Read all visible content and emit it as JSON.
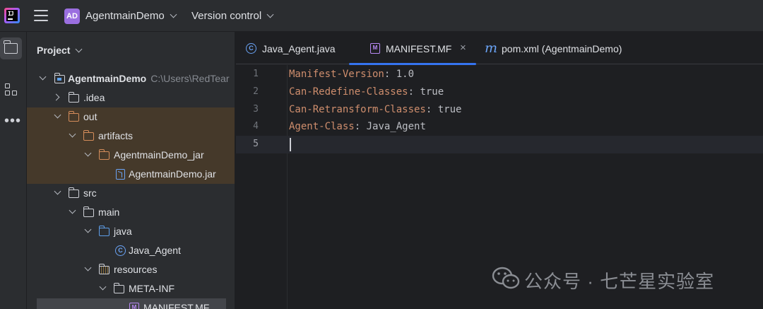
{
  "titlebar": {
    "project_badge": "AD",
    "project_name": "AgentmainDemo",
    "vcs_label": "Version control"
  },
  "project_panel": {
    "title": "Project",
    "tree": [
      {
        "label": "AgentmainDemo",
        "path": "C:\\Users\\RedTear"
      },
      {
        "label": ".idea"
      },
      {
        "label": "out"
      },
      {
        "label": "artifacts"
      },
      {
        "label": "AgentmainDemo_jar"
      },
      {
        "label": "AgentmainDemo.jar"
      },
      {
        "label": "src"
      },
      {
        "label": "main"
      },
      {
        "label": "java"
      },
      {
        "label": "Java_Agent"
      },
      {
        "label": "resources"
      },
      {
        "label": "META-INF"
      },
      {
        "label": "MANIFEST.MF"
      }
    ]
  },
  "tabs": [
    {
      "label": "Java_Agent.java",
      "icon": "java-class-icon"
    },
    {
      "label": "MANIFEST.MF",
      "icon": "manifest-icon",
      "active": true
    },
    {
      "label": "pom.xml (AgentmainDemo)",
      "icon": "maven-icon"
    }
  ],
  "tab_close_glyph": "×",
  "editor": {
    "lines": [
      {
        "num": "1",
        "key": "Manifest-Version",
        "value": " 1.0"
      },
      {
        "num": "2",
        "key": "Can-Redefine-Classes",
        "value": " true"
      },
      {
        "num": "3",
        "key": "Can-Retransform-Classes",
        "value": " true"
      },
      {
        "num": "4",
        "key": "Agent-Class",
        "value": " Java_Agent"
      },
      {
        "num": "5",
        "key": "",
        "value": ""
      }
    ],
    "current_line": 5
  },
  "watermark": {
    "text": "公众号 · 七芒星实验室"
  },
  "colors": {
    "accent": "#3574f0",
    "key": "#cf8e6d",
    "highlight_row": "#45392a",
    "project_badge": "#9b6fe0"
  }
}
